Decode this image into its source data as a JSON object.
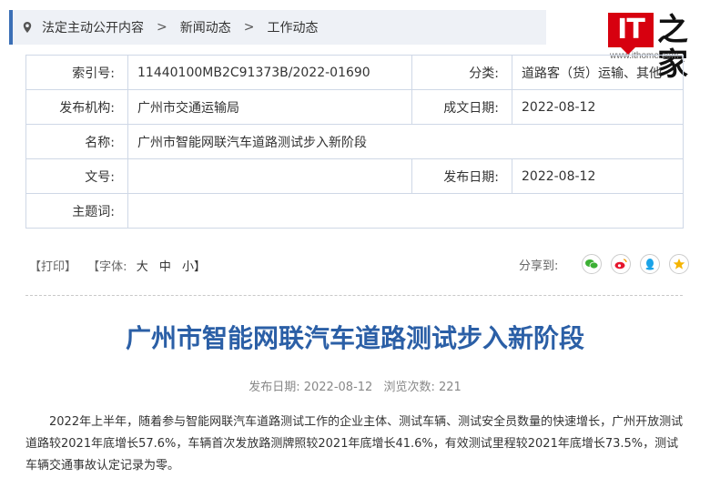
{
  "breadcrumb": {
    "items": [
      "法定主动公开内容",
      "新闻动态",
      "工作动态"
    ],
    "separator": ">"
  },
  "logo": {
    "mark": "IT",
    "chars": "之家",
    "url": "www.ithome.com"
  },
  "meta": {
    "index_label": "索引号:",
    "index_value": "11440100MB2C91373B/2022-01690",
    "category_label": "分类:",
    "category_value": "道路客（货）运输、其他",
    "publisher_label": "发布机构:",
    "publisher_value": "广州市交通运输局",
    "created_label": "成文日期:",
    "created_value": "2022-08-12",
    "name_label": "名称:",
    "name_value": "广州市智能网联汽车道路测试步入新阶段",
    "docno_label": "文号:",
    "docno_value": "",
    "pubdate_label": "发布日期:",
    "pubdate_value": "2022-08-12",
    "subject_label": "主题词:",
    "subject_value": ""
  },
  "tools": {
    "print": "【打印】",
    "font_label": "【字体:",
    "large": "大",
    "medium": "中",
    "small": "小】"
  },
  "share": {
    "label": "分享到:",
    "icons": [
      "wechat-icon",
      "weibo-icon",
      "qq-icon",
      "qzone-icon"
    ]
  },
  "article": {
    "title": "广州市智能网联汽车道路测试步入新阶段",
    "date_text": "发布日期: 2022-08-12",
    "views_text": "浏览次数: 221",
    "paragraph": "2022年上半年，随着参与智能网联汽车道路测试工作的企业主体、测试车辆、测试安全员数量的快速增长，广州开放测试道路较2021年底增长57.6%，车辆首次发放路测牌照较2021年底增长41.6%，有效测试里程较2021年底增长73.5%，测试车辆交通事故认定记录为零。"
  },
  "colors": {
    "accent": "#3b6fb6",
    "title": "#2b5fa6",
    "logo_red": "#d7000f",
    "wechat": "#3cb034",
    "weibo": "#e6162d",
    "qq": "#1aa3e8",
    "qzone": "#f5b400"
  }
}
